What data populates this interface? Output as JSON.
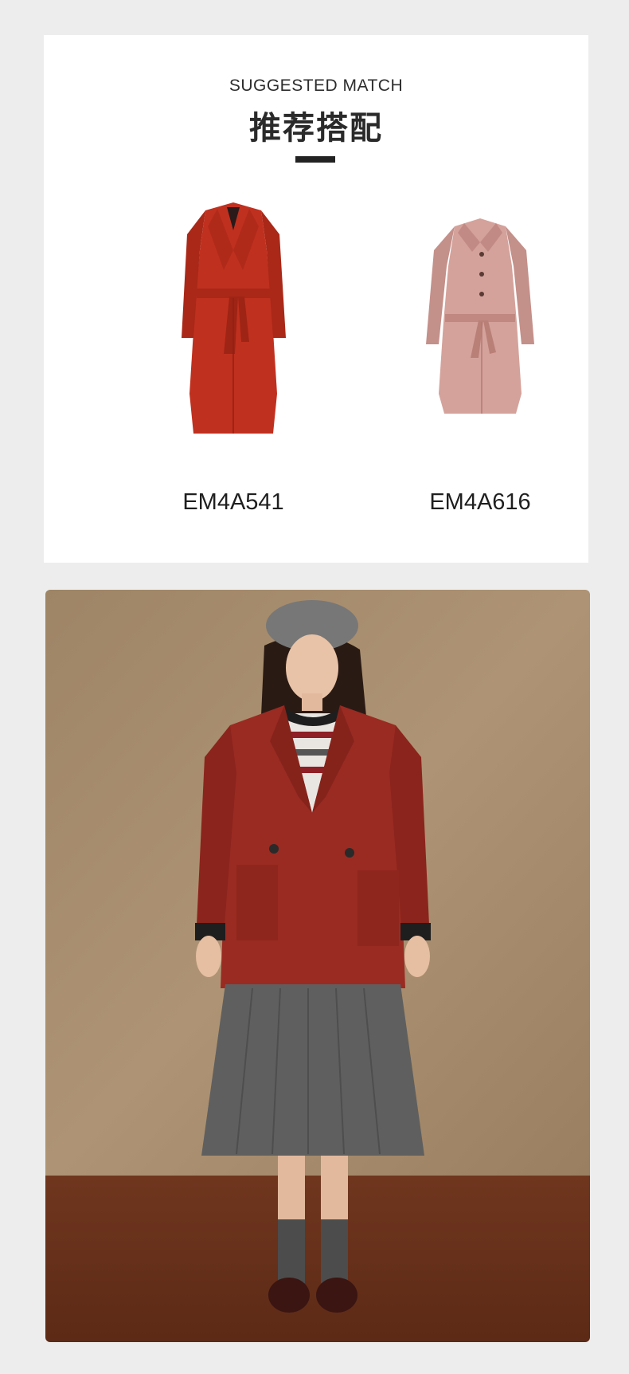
{
  "section": {
    "subtitle": "SUGGESTED MATCH",
    "title": "推荐搭配"
  },
  "products": [
    {
      "code": "EM4A541",
      "image": "red-long-belted-coat",
      "color": "#c0301f"
    },
    {
      "code": "EM4A616",
      "image": "pink-belted-coat",
      "color": "#d4a29b"
    }
  ],
  "model_photo": {
    "image": "model-wearing-red-double-breasted-coat",
    "coat_color": "#9a2b22",
    "skirt_color": "#5f5f5f",
    "backdrop_color": "#a88d6e",
    "floor_color": "#6b331c"
  }
}
